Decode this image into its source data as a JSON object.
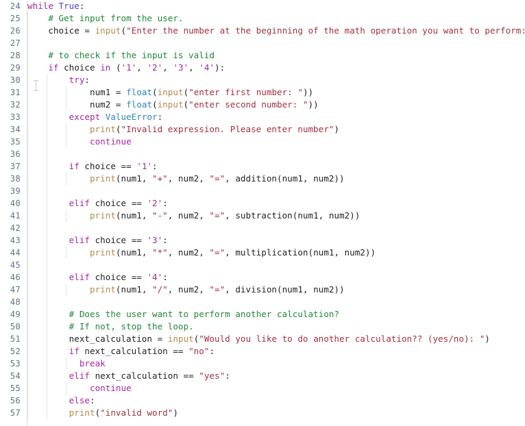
{
  "editor": {
    "language": "python",
    "background_color": "#ffffff",
    "gutter_color": "#5b7387",
    "indent_guide_color": "#dfe3e6",
    "first_visible_line": 24,
    "last_visible_line": 57,
    "line_height_px": 18,
    "indent_guide_x": [
      40,
      68,
      96,
      124
    ],
    "theme_colors": {
      "keyword": "#a626a4",
      "constant": "#4a3fd6",
      "builtin_type": "#2b86b8",
      "function": "#b38b4d",
      "string": "#a0323c",
      "char_literal": "#9a2b8c",
      "exception": "#2b86b8",
      "comment": "#22863a",
      "plain": "#222222"
    },
    "mouse_cursor": "text-ibeam-cursor"
  },
  "lines": [
    {
      "n": "24",
      "guides": 0,
      "tokens": [
        {
          "t": "while",
          "c": "kw"
        },
        {
          "t": " ",
          "c": "pl"
        },
        {
          "t": "True",
          "c": "const"
        },
        {
          "t": ":",
          "c": "pl"
        }
      ]
    },
    {
      "n": "25",
      "guides": 1,
      "tokens": [
        {
          "t": "    ",
          "c": "pl"
        },
        {
          "t": "# Get input from the user.",
          "c": "cmt"
        }
      ]
    },
    {
      "n": "26",
      "guides": 1,
      "tokens": [
        {
          "t": "    choice ",
          "c": "pl"
        },
        {
          "t": "=",
          "c": "op"
        },
        {
          "t": " ",
          "c": "pl"
        },
        {
          "t": "input",
          "c": "fn"
        },
        {
          "t": "(",
          "c": "pl"
        },
        {
          "t": "\"Enter the number at the beginning of the math operation you want to perform: \"",
          "c": "str"
        },
        {
          "t": ")",
          "c": "pl"
        }
      ]
    },
    {
      "n": "27",
      "guides": 1,
      "tokens": []
    },
    {
      "n": "28",
      "guides": 1,
      "tokens": [
        {
          "t": "    ",
          "c": "pl"
        },
        {
          "t": "# to check if the input is valid",
          "c": "cmt"
        }
      ]
    },
    {
      "n": "29",
      "guides": 1,
      "tokens": [
        {
          "t": "    ",
          "c": "pl"
        },
        {
          "t": "if",
          "c": "kw"
        },
        {
          "t": " choice ",
          "c": "pl"
        },
        {
          "t": "in",
          "c": "kw"
        },
        {
          "t": " (",
          "c": "pl"
        },
        {
          "t": "'1'",
          "c": "strq"
        },
        {
          "t": ", ",
          "c": "pl"
        },
        {
          "t": "'2'",
          "c": "strq"
        },
        {
          "t": ", ",
          "c": "pl"
        },
        {
          "t": "'3'",
          "c": "strq"
        },
        {
          "t": ", ",
          "c": "pl"
        },
        {
          "t": "'4'",
          "c": "strq"
        },
        {
          "t": "):",
          "c": "pl"
        }
      ]
    },
    {
      "n": "30",
      "guides": 2,
      "tokens": [
        {
          "t": "        ",
          "c": "pl"
        },
        {
          "t": "try",
          "c": "kw"
        },
        {
          "t": ":",
          "c": "pl"
        }
      ]
    },
    {
      "n": "31",
      "guides": 3,
      "tokens": [
        {
          "t": "            num1 ",
          "c": "pl"
        },
        {
          "t": "=",
          "c": "op"
        },
        {
          "t": " ",
          "c": "pl"
        },
        {
          "t": "float",
          "c": "bi"
        },
        {
          "t": "(",
          "c": "pl"
        },
        {
          "t": "input",
          "c": "fn"
        },
        {
          "t": "(",
          "c": "pl"
        },
        {
          "t": "\"enter first number: \"",
          "c": "str"
        },
        {
          "t": "))",
          "c": "pl"
        }
      ]
    },
    {
      "n": "32",
      "guides": 3,
      "tokens": [
        {
          "t": "            num2 ",
          "c": "pl"
        },
        {
          "t": "=",
          "c": "op"
        },
        {
          "t": " ",
          "c": "pl"
        },
        {
          "t": "float",
          "c": "bi"
        },
        {
          "t": "(",
          "c": "pl"
        },
        {
          "t": "input",
          "c": "fn"
        },
        {
          "t": "(",
          "c": "pl"
        },
        {
          "t": "\"enter second number: \"",
          "c": "str"
        },
        {
          "t": "))",
          "c": "pl"
        }
      ]
    },
    {
      "n": "33",
      "guides": 2,
      "tokens": [
        {
          "t": "        ",
          "c": "pl"
        },
        {
          "t": "except",
          "c": "kw"
        },
        {
          "t": " ",
          "c": "pl"
        },
        {
          "t": "ValueError",
          "c": "exc"
        },
        {
          "t": ":",
          "c": "pl"
        }
      ]
    },
    {
      "n": "34",
      "guides": 3,
      "tokens": [
        {
          "t": "            ",
          "c": "pl"
        },
        {
          "t": "print",
          "c": "fn"
        },
        {
          "t": "(",
          "c": "pl"
        },
        {
          "t": "\"Invalid expression. Please enter number\"",
          "c": "str"
        },
        {
          "t": ")",
          "c": "pl"
        }
      ]
    },
    {
      "n": "35",
      "guides": 3,
      "tokens": [
        {
          "t": "            ",
          "c": "pl"
        },
        {
          "t": "continue",
          "c": "kw"
        }
      ]
    },
    {
      "n": "36",
      "guides": 2,
      "tokens": []
    },
    {
      "n": "37",
      "guides": 2,
      "tokens": [
        {
          "t": "        ",
          "c": "pl"
        },
        {
          "t": "if",
          "c": "kw"
        },
        {
          "t": " choice ",
          "c": "pl"
        },
        {
          "t": "==",
          "c": "op"
        },
        {
          "t": " ",
          "c": "pl"
        },
        {
          "t": "'1'",
          "c": "strq"
        },
        {
          "t": ":",
          "c": "pl"
        }
      ]
    },
    {
      "n": "38",
      "guides": 3,
      "tokens": [
        {
          "t": "            ",
          "c": "pl"
        },
        {
          "t": "print",
          "c": "fn"
        },
        {
          "t": "(num1, ",
          "c": "pl"
        },
        {
          "t": "\"+\"",
          "c": "str"
        },
        {
          "t": ", num2, ",
          "c": "pl"
        },
        {
          "t": "\"=\"",
          "c": "str"
        },
        {
          "t": ", addition(num1, num2))",
          "c": "pl"
        }
      ]
    },
    {
      "n": "39",
      "guides": 2,
      "tokens": []
    },
    {
      "n": "40",
      "guides": 2,
      "tokens": [
        {
          "t": "        ",
          "c": "pl"
        },
        {
          "t": "elif",
          "c": "kw"
        },
        {
          "t": " choice ",
          "c": "pl"
        },
        {
          "t": "==",
          "c": "op"
        },
        {
          "t": " ",
          "c": "pl"
        },
        {
          "t": "'2'",
          "c": "strq"
        },
        {
          "t": ":",
          "c": "pl"
        }
      ]
    },
    {
      "n": "41",
      "guides": 3,
      "tokens": [
        {
          "t": "            ",
          "c": "pl"
        },
        {
          "t": "print",
          "c": "fn"
        },
        {
          "t": "(num1, ",
          "c": "pl"
        },
        {
          "t": "\"-\"",
          "c": "str"
        },
        {
          "t": ", num2, ",
          "c": "pl"
        },
        {
          "t": "\"=\"",
          "c": "str"
        },
        {
          "t": ", subtraction(num1, num2))",
          "c": "pl"
        }
      ]
    },
    {
      "n": "42",
      "guides": 2,
      "tokens": []
    },
    {
      "n": "43",
      "guides": 2,
      "tokens": [
        {
          "t": "        ",
          "c": "pl"
        },
        {
          "t": "elif",
          "c": "kw"
        },
        {
          "t": " choice ",
          "c": "pl"
        },
        {
          "t": "==",
          "c": "op"
        },
        {
          "t": " ",
          "c": "pl"
        },
        {
          "t": "'3'",
          "c": "strq"
        },
        {
          "t": ":",
          "c": "pl"
        }
      ]
    },
    {
      "n": "44",
      "guides": 3,
      "tokens": [
        {
          "t": "            ",
          "c": "pl"
        },
        {
          "t": "print",
          "c": "fn"
        },
        {
          "t": "(num1, ",
          "c": "pl"
        },
        {
          "t": "\"*\"",
          "c": "str"
        },
        {
          "t": ", num2, ",
          "c": "pl"
        },
        {
          "t": "\"=\"",
          "c": "str"
        },
        {
          "t": ", multiplication(num1, num2))",
          "c": "pl"
        }
      ]
    },
    {
      "n": "45",
      "guides": 2,
      "tokens": []
    },
    {
      "n": "46",
      "guides": 2,
      "tokens": [
        {
          "t": "        ",
          "c": "pl"
        },
        {
          "t": "elif",
          "c": "kw"
        },
        {
          "t": " choice ",
          "c": "pl"
        },
        {
          "t": "==",
          "c": "op"
        },
        {
          "t": " ",
          "c": "pl"
        },
        {
          "t": "'4'",
          "c": "strq"
        },
        {
          "t": ":",
          "c": "pl"
        }
      ]
    },
    {
      "n": "47",
      "guides": 3,
      "tokens": [
        {
          "t": "            ",
          "c": "pl"
        },
        {
          "t": "print",
          "c": "fn"
        },
        {
          "t": "(num1, ",
          "c": "pl"
        },
        {
          "t": "\"/\"",
          "c": "str"
        },
        {
          "t": ", num2, ",
          "c": "pl"
        },
        {
          "t": "\"=\"",
          "c": "str"
        },
        {
          "t": ", division(num1, num2))",
          "c": "pl"
        }
      ]
    },
    {
      "n": "48",
      "guides": 2,
      "tokens": []
    },
    {
      "n": "49",
      "guides": 2,
      "tokens": [
        {
          "t": "        ",
          "c": "pl"
        },
        {
          "t": "# Does the user want to perform another calculation?",
          "c": "cmt"
        }
      ]
    },
    {
      "n": "50",
      "guides": 2,
      "tokens": [
        {
          "t": "        ",
          "c": "pl"
        },
        {
          "t": "# If not, stop the loop.",
          "c": "cmt"
        }
      ]
    },
    {
      "n": "51",
      "guides": 2,
      "tokens": [
        {
          "t": "        next_calculation ",
          "c": "pl"
        },
        {
          "t": "=",
          "c": "op"
        },
        {
          "t": " ",
          "c": "pl"
        },
        {
          "t": "input",
          "c": "fn"
        },
        {
          "t": "(",
          "c": "pl"
        },
        {
          "t": "\"Would you like to do another calculation?? (yes/no): \"",
          "c": "str"
        },
        {
          "t": ")",
          "c": "pl"
        }
      ]
    },
    {
      "n": "52",
      "guides": 2,
      "tokens": [
        {
          "t": "        ",
          "c": "pl"
        },
        {
          "t": "if",
          "c": "kw"
        },
        {
          "t": " next_calculation ",
          "c": "pl"
        },
        {
          "t": "==",
          "c": "op"
        },
        {
          "t": " ",
          "c": "pl"
        },
        {
          "t": "\"no\"",
          "c": "str"
        },
        {
          "t": ":",
          "c": "pl"
        }
      ]
    },
    {
      "n": "53",
      "guides": 3,
      "tokens": [
        {
          "t": "          ",
          "c": "pl"
        },
        {
          "t": "break",
          "c": "kw"
        }
      ]
    },
    {
      "n": "54",
      "guides": 2,
      "tokens": [
        {
          "t": "        ",
          "c": "pl"
        },
        {
          "t": "elif",
          "c": "kw"
        },
        {
          "t": " next_calculation ",
          "c": "pl"
        },
        {
          "t": "==",
          "c": "op"
        },
        {
          "t": " ",
          "c": "pl"
        },
        {
          "t": "\"yes\"",
          "c": "str"
        },
        {
          "t": ":",
          "c": "pl"
        }
      ]
    },
    {
      "n": "55",
      "guides": 3,
      "tokens": [
        {
          "t": "            ",
          "c": "pl"
        },
        {
          "t": "continue",
          "c": "kw"
        }
      ]
    },
    {
      "n": "56",
      "guides": 2,
      "tokens": [
        {
          "t": "        ",
          "c": "pl"
        },
        {
          "t": "else",
          "c": "kw"
        },
        {
          "t": ":",
          "c": "pl"
        }
      ]
    },
    {
      "n": "57",
      "guides": 2,
      "tokens": [
        {
          "t": "        ",
          "c": "pl"
        },
        {
          "t": "print",
          "c": "fn"
        },
        {
          "t": "(",
          "c": "pl"
        },
        {
          "t": "\"invalid word\"",
          "c": "str"
        },
        {
          "t": ")",
          "c": "pl"
        }
      ]
    }
  ]
}
